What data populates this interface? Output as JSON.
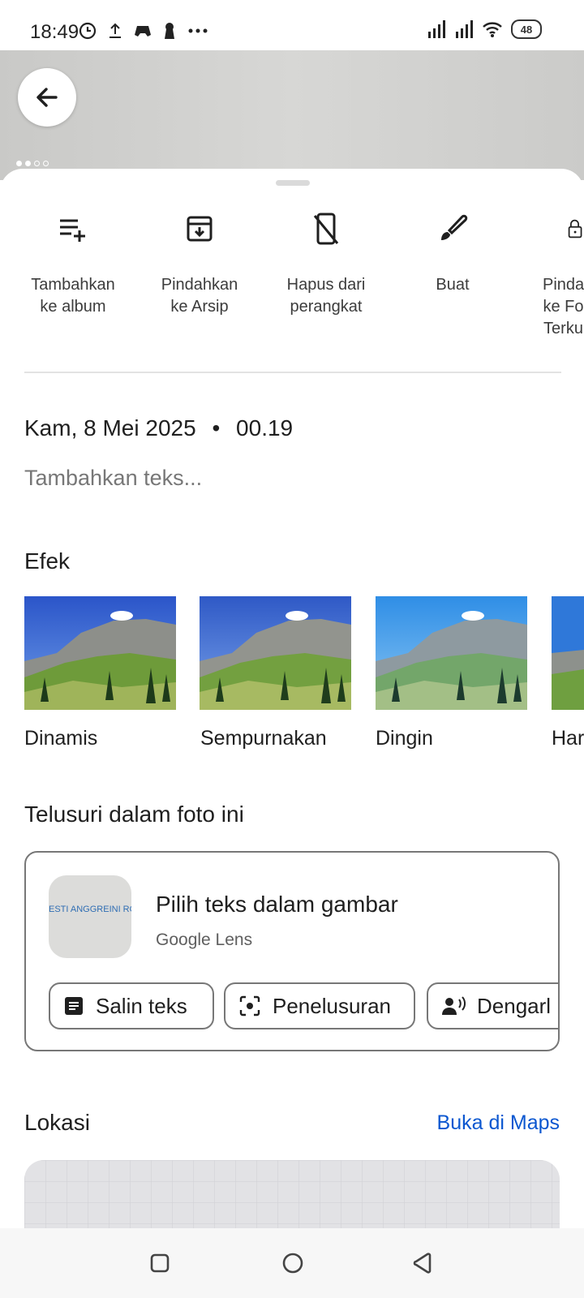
{
  "status_bar": {
    "time": "18:49",
    "battery": "48"
  },
  "actions": [
    {
      "label": "Tambahkan\nke album",
      "icon": "playlist-add-icon"
    },
    {
      "label": "Pindahkan\nke Arsip",
      "icon": "archive-icon"
    },
    {
      "label": "Hapus dari\nperangkat",
      "icon": "phone-delete-icon"
    },
    {
      "label": "Buat",
      "icon": "brush-icon"
    },
    {
      "label": "Pinda\nke Fo\nTerku",
      "icon": "lock-icon"
    }
  ],
  "details": {
    "date": "Kam, 8 Mei 2025",
    "separator": "•",
    "time": "00.19",
    "add_text_placeholder": "Tambahkan teks..."
  },
  "effects": {
    "title": "Efek",
    "items": [
      "Dinamis",
      "Sempurnakan",
      "Dingin",
      "Har"
    ]
  },
  "lens": {
    "section_title": "Telusuri dalam foto ini",
    "title": "Pilih teks dalam gambar",
    "subtitle": "Google Lens",
    "thumb_text": "ESTI ANGGREINI ROB",
    "chips": [
      "Salin teks",
      "Penelusuran",
      "Dengarl"
    ]
  },
  "location": {
    "title": "Lokasi",
    "maps_link": "Buka di Maps"
  },
  "colors": {
    "accent": "#0b57d0"
  }
}
